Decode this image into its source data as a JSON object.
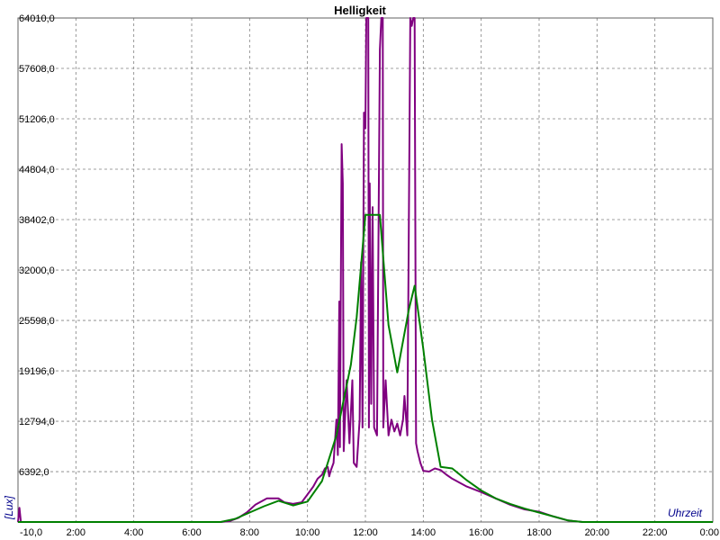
{
  "chart_data": {
    "type": "line",
    "title": "Helligkeit",
    "xlabel": "Uhrzeit",
    "ylabel": "[Lux]",
    "xlim": [
      0,
      24
    ],
    "ylim": [
      0,
      64010
    ],
    "grid": true,
    "x_tick_labels": [
      "-10,0",
      "2:00",
      "4:00",
      "6:00",
      "8:00",
      "10:00",
      "12:00",
      "14:00",
      "16:00",
      "18:00",
      "20:00",
      "22:00",
      "0:00"
    ],
    "y_tick_labels": [
      "6392,0",
      "12794,0",
      "19196,0",
      "25598,0",
      "32000,0",
      "38402,0",
      "44804,0",
      "51206,0",
      "57608,0",
      "64010,0"
    ],
    "y_tick_values": [
      6392,
      12794,
      19196,
      25598,
      32000,
      38402,
      44804,
      51206,
      57608,
      64010
    ],
    "series": [
      {
        "color": "#800080",
        "points": [
          [
            0.0,
            0
          ],
          [
            0.05,
            1800
          ],
          [
            0.1,
            0
          ],
          [
            7.0,
            0
          ],
          [
            7.3,
            100
          ],
          [
            7.6,
            500
          ],
          [
            7.9,
            1200
          ],
          [
            8.2,
            2200
          ],
          [
            8.6,
            3000
          ],
          [
            9.0,
            3000
          ],
          [
            9.2,
            2500
          ],
          [
            9.5,
            2300
          ],
          [
            9.8,
            2500
          ],
          [
            10.0,
            3500
          ],
          [
            10.2,
            4500
          ],
          [
            10.35,
            5500
          ],
          [
            10.5,
            6000
          ],
          [
            10.6,
            6800
          ],
          [
            10.7,
            7000
          ],
          [
            10.75,
            5800
          ],
          [
            10.8,
            6500
          ],
          [
            10.9,
            7500
          ],
          [
            11.0,
            13000
          ],
          [
            11.05,
            8500
          ],
          [
            11.1,
            28000
          ],
          [
            11.12,
            9500
          ],
          [
            11.18,
            48000
          ],
          [
            11.22,
            43000
          ],
          [
            11.25,
            9000
          ],
          [
            11.35,
            18000
          ],
          [
            11.45,
            10000
          ],
          [
            11.55,
            18000
          ],
          [
            11.6,
            7500
          ],
          [
            11.7,
            7000
          ],
          [
            11.8,
            13000
          ],
          [
            11.85,
            33000
          ],
          [
            11.9,
            12000
          ],
          [
            11.95,
            52000
          ],
          [
            12.0,
            50000
          ],
          [
            12.03,
            64010
          ],
          [
            12.1,
            64010
          ],
          [
            12.12,
            12000
          ],
          [
            12.15,
            43000
          ],
          [
            12.2,
            15000
          ],
          [
            12.25,
            40000
          ],
          [
            12.3,
            12000
          ],
          [
            12.4,
            11000
          ],
          [
            12.5,
            60000
          ],
          [
            12.55,
            64010
          ],
          [
            12.6,
            64010
          ],
          [
            12.62,
            12000
          ],
          [
            12.7,
            18000
          ],
          [
            12.8,
            11000
          ],
          [
            12.9,
            13000
          ],
          [
            13.0,
            11500
          ],
          [
            13.1,
            12500
          ],
          [
            13.2,
            11000
          ],
          [
            13.3,
            13000
          ],
          [
            13.35,
            16000
          ],
          [
            13.45,
            11000
          ],
          [
            13.55,
            64010
          ],
          [
            13.6,
            63000
          ],
          [
            13.65,
            64010
          ],
          [
            13.7,
            64010
          ],
          [
            13.75,
            10000
          ],
          [
            13.8,
            9000
          ],
          [
            13.9,
            7500
          ],
          [
            14.0,
            6500
          ],
          [
            14.2,
            6400
          ],
          [
            14.4,
            6800
          ],
          [
            14.6,
            6600
          ],
          [
            14.8,
            6000
          ],
          [
            15.0,
            5500
          ],
          [
            15.5,
            4500
          ],
          [
            16.0,
            3800
          ],
          [
            16.5,
            3000
          ],
          [
            17.0,
            2200
          ],
          [
            17.5,
            1600
          ],
          [
            18.0,
            1300
          ],
          [
            18.5,
            700
          ],
          [
            19.0,
            200
          ],
          [
            19.5,
            0
          ],
          [
            24.0,
            0
          ]
        ]
      },
      {
        "color": "#008000",
        "points": [
          [
            0.0,
            0
          ],
          [
            7.0,
            0
          ],
          [
            7.5,
            400
          ],
          [
            8.0,
            1200
          ],
          [
            8.5,
            2000
          ],
          [
            9.0,
            2700
          ],
          [
            9.5,
            2100
          ],
          [
            10.0,
            2600
          ],
          [
            10.5,
            5200
          ],
          [
            11.0,
            11000
          ],
          [
            11.5,
            20000
          ],
          [
            11.7,
            26000
          ],
          [
            12.0,
            39000
          ],
          [
            12.5,
            39000
          ],
          [
            12.8,
            25000
          ],
          [
            13.1,
            19000
          ],
          [
            13.5,
            27000
          ],
          [
            13.7,
            30000
          ],
          [
            14.0,
            22000
          ],
          [
            14.3,
            13000
          ],
          [
            14.6,
            7000
          ],
          [
            15.0,
            6800
          ],
          [
            15.5,
            5300
          ],
          [
            16.0,
            4000
          ],
          [
            16.5,
            3000
          ],
          [
            17.0,
            2300
          ],
          [
            17.5,
            1700
          ],
          [
            18.0,
            1200
          ],
          [
            18.5,
            700
          ],
          [
            19.0,
            200
          ],
          [
            19.5,
            0
          ],
          [
            24.0,
            0
          ]
        ]
      }
    ]
  }
}
